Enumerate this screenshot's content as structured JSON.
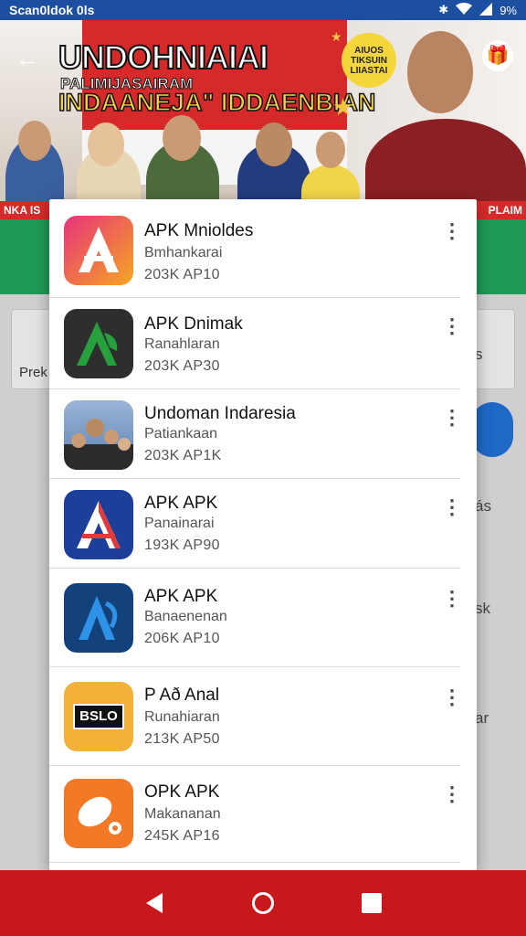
{
  "status_bar": {
    "carrier": "Scan0ldok 0ls",
    "bluetooth_icon": "bluetooth-icon",
    "wifi_icon": "wifi-icon",
    "signal_icon": "signal-icon",
    "battery": "9%"
  },
  "hero": {
    "title": "UNDOHNIAIAI",
    "subtitle_small": "PALIMIJASAIRAM",
    "subtitle_large": "INDAANEJA\" IDDAENBIAN",
    "bubble_text": "AIUOS TIKSUIN LIIASTAI",
    "ribbon_left": "NKA IS",
    "ribbon_right": "PLAIM",
    "back_icon": "arrow-left-icon",
    "gift_icon": "gift-icon"
  },
  "background": {
    "left_card_label": "Prek",
    "right_texts": [
      "s",
      "ás",
      "sk",
      "ar"
    ]
  },
  "apps": [
    {
      "title": "APK Mnioldes",
      "subtitle": "Bmhankarai",
      "meta": "203K AP10",
      "icon": "app-letter-a-gradient-icon",
      "colors": [
        "#e8337a",
        "#f5a623"
      ]
    },
    {
      "title": "APK Dnimak",
      "subtitle": "Ranahlaran",
      "meta": "203K AP30",
      "icon": "app-letter-a-green-icon",
      "colors": [
        "#2e2e2e",
        "#26a03c"
      ]
    },
    {
      "title": "Undoman Indaresia",
      "subtitle": "Patiankaan",
      "meta": "203K AP1K",
      "icon": "group-photo-icon",
      "colors": [
        "#5a7fb2",
        "#c99a73"
      ]
    },
    {
      "title": "APK APK",
      "subtitle": "Panainarai",
      "meta": "193K AP90",
      "icon": "app-letter-a-red-icon",
      "colors": [
        "#1d3f9a",
        "#e03a3a"
      ]
    },
    {
      "title": "APK APK",
      "subtitle": "Banaenenan",
      "meta": "206K AP10",
      "icon": "app-letter-a-blue-icon",
      "colors": [
        "#13427a",
        "#2e93e8"
      ]
    },
    {
      "title": "P Að Anal",
      "subtitle": "Runahiaran",
      "meta": "213K AP50",
      "icon": "app-badge-label-icon",
      "colors": [
        "#f2b23a",
        "#111111"
      ]
    },
    {
      "title": "OPK APK",
      "subtitle": "Makananan",
      "meta": "245K AP16",
      "icon": "app-earbud-icon",
      "colors": [
        "#f27a26",
        "#ffffff"
      ]
    }
  ],
  "badge_text": "BSLO",
  "navigation": {
    "back_icon": "triangle-back-icon",
    "home_icon": "circle-home-icon",
    "recents_icon": "square-recents-icon"
  }
}
